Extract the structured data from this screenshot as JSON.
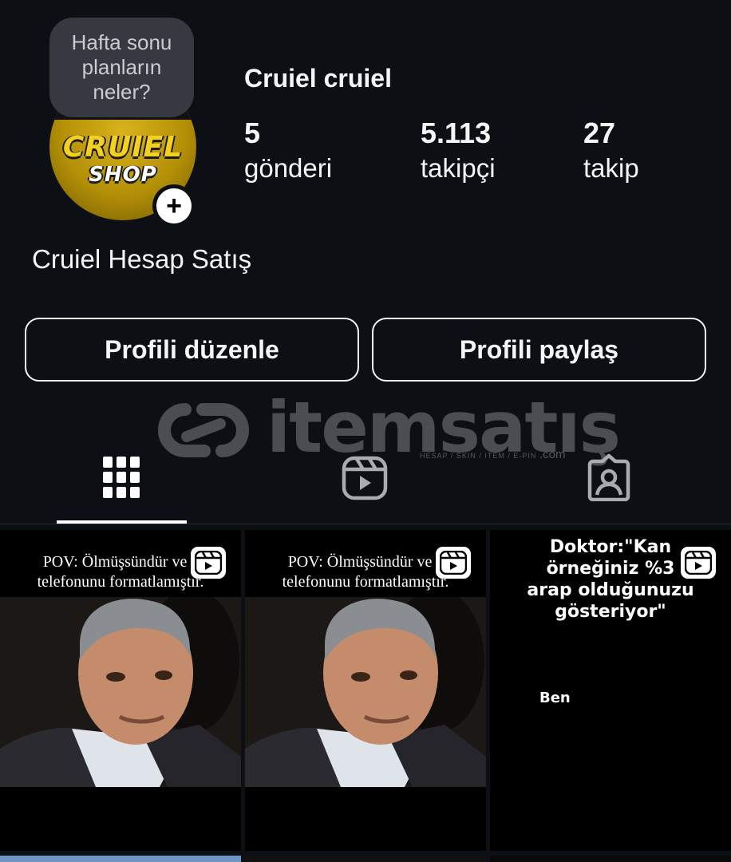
{
  "profile": {
    "note": "Hafta sonu planların neler?",
    "avatar_logo_line1": "CRUIEL",
    "avatar_logo_line2": "SHOP",
    "name": "Cruiel cruiel",
    "bio_name": "Cruiel Hesap Satış",
    "stats": [
      {
        "value": "5",
        "label": "gönderi"
      },
      {
        "value": "5.113",
        "label": "takipçi"
      },
      {
        "value": "27",
        "label": "takip"
      }
    ]
  },
  "buttons": {
    "edit_profile": "Profili düzenle",
    "share_profile": "Profili paylaş"
  },
  "watermark": {
    "text": "itemsatış",
    "sub": "HESAP / SKIN / ITEM / E-PIN",
    "suffix": ".com"
  },
  "tabs": [
    {
      "icon": "grid-icon",
      "active": true
    },
    {
      "icon": "reels-icon",
      "active": false
    },
    {
      "icon": "tagged-icon",
      "active": false
    }
  ],
  "posts": [
    {
      "type": "reel",
      "caption_line1": "POV: Ölmüşsündür ve a",
      "caption_line2": "telefonunu formatlamıştır."
    },
    {
      "type": "reel",
      "caption_line1": "POV: Ölmüşsündür ve a",
      "caption_line2": "telefonunu formatlamıştır."
    },
    {
      "type": "reel",
      "meme_line1": "Doktor:\"Kan",
      "meme_line2": "örneğiniz %3",
      "meme_line3": "arap olduğunuzu",
      "meme_line4": "gösteriyor\"",
      "meme_ben": "Ben"
    }
  ],
  "colors": {
    "background": "#0c1014",
    "note_bubble": "#363a40",
    "avatar_gold": "#d8b31b"
  }
}
